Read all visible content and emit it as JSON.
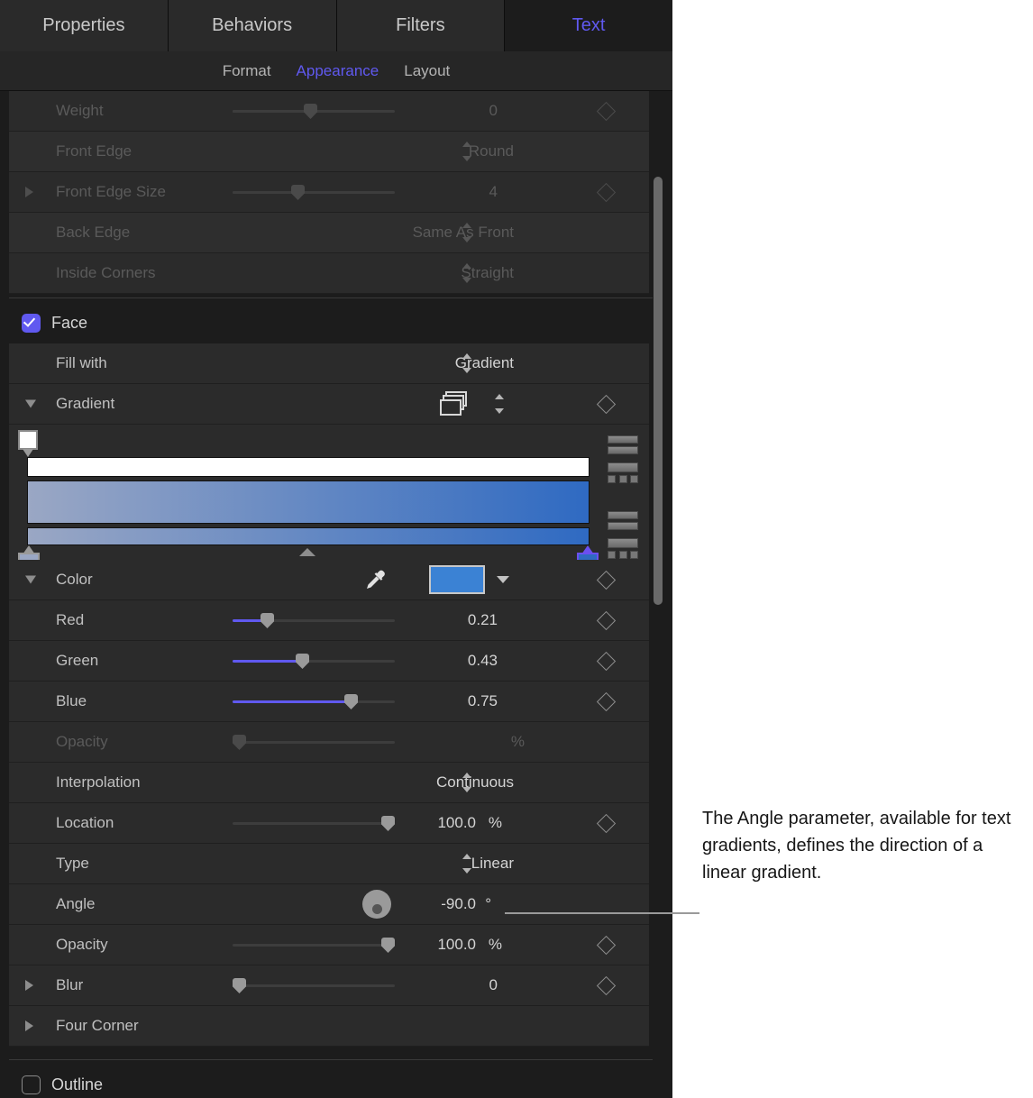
{
  "tabs": [
    {
      "label": "Properties",
      "active": false
    },
    {
      "label": "Behaviors",
      "active": false
    },
    {
      "label": "Filters",
      "active": false
    },
    {
      "label": "Text",
      "active": true
    }
  ],
  "subtabs": [
    {
      "label": "Format",
      "active": false
    },
    {
      "label": "Appearance",
      "active": true
    },
    {
      "label": "Layout",
      "active": false
    }
  ],
  "rows": {
    "weight": {
      "label": "Weight",
      "value": "0"
    },
    "front_edge": {
      "label": "Front Edge",
      "value": "Round"
    },
    "front_edge_size": {
      "label": "Front Edge Size",
      "value": "4"
    },
    "back_edge": {
      "label": "Back Edge",
      "value": "Same As Front"
    },
    "inside_corners": {
      "label": "Inside Corners",
      "value": "Straight"
    },
    "face": {
      "label": "Face"
    },
    "fill_with": {
      "label": "Fill with",
      "value": "Gradient"
    },
    "gradient": {
      "label": "Gradient"
    },
    "color": {
      "label": "Color"
    },
    "red": {
      "label": "Red",
      "value": "0.21"
    },
    "green": {
      "label": "Green",
      "value": "0.43"
    },
    "blue": {
      "label": "Blue",
      "value": "0.75"
    },
    "stop_opacity": {
      "label": "Opacity",
      "value": "",
      "unit": "%"
    },
    "interpolation": {
      "label": "Interpolation",
      "value": "Continuous"
    },
    "location": {
      "label": "Location",
      "value": "100.0",
      "unit": "%"
    },
    "type": {
      "label": "Type",
      "value": "Linear"
    },
    "angle": {
      "label": "Angle",
      "value": "-90.0",
      "unit": "°"
    },
    "face_opacity": {
      "label": "Opacity",
      "value": "100.0",
      "unit": "%"
    },
    "blur": {
      "label": "Blur",
      "value": "0"
    },
    "four_corner": {
      "label": "Four Corner"
    },
    "outline": {
      "label": "Outline"
    }
  },
  "gradient_editor": {
    "opacity_track_color": "#ffffff",
    "color_start": "#9aa7c4",
    "color_end": "#2f6ac2",
    "stops": [
      {
        "name": "opacity-stop-left",
        "position_pct": 0,
        "color": "#ffffff",
        "selected": false
      },
      {
        "name": "color-stop-left",
        "position_pct": 0,
        "color": "#9aa7c4",
        "selected": false
      },
      {
        "name": "color-stop-right",
        "position_pct": 100,
        "color": "#2f6ac2",
        "selected": true
      },
      {
        "name": "midpoint-marker",
        "position_pct": 50,
        "color": "#8d8d8d",
        "selected": false
      }
    ]
  },
  "color_swatch": "#3b82d4",
  "accent": "#6059f0",
  "sliders": {
    "weight_pct": 48,
    "front_edge_size_pct": 48,
    "red_pct": 21,
    "green_pct": 43,
    "blue_pct": 75,
    "stop_opacity_pct": 0,
    "location_pct": 100,
    "face_opacity_pct": 100,
    "blur_pct": 2
  },
  "callout": {
    "text": "The Angle parameter, available for text gradients, defines the direction of a linear gradient."
  }
}
